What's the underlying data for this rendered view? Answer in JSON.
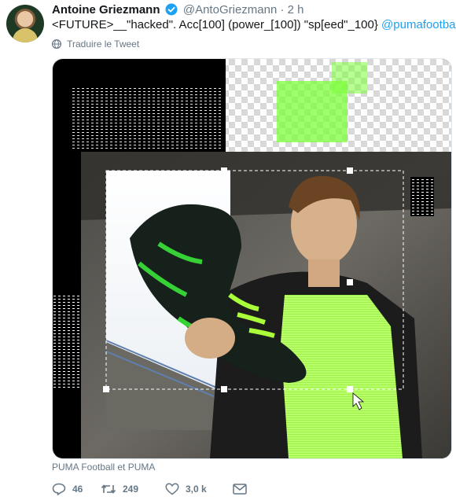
{
  "tweet": {
    "author_name": "Antoine Griezmann",
    "handle": "@AntoGriezmann",
    "separator": "·",
    "time": "2 h",
    "text": "<FUTURE>__\"hacked\". Acc[100] (power_[100]) \"sp[eed\"_100}",
    "mention": "@pumafootball",
    "translate_label": "Traduire le Tweet",
    "media_caption": "PUMA Football et PUMA",
    "replies": "46",
    "retweets": "249",
    "likes": "3,0 k"
  },
  "colors": {
    "link": "#1da1f2",
    "secondary_text": "#657786",
    "verified": "#1da1f2",
    "neon_green": "#7cff3a"
  }
}
